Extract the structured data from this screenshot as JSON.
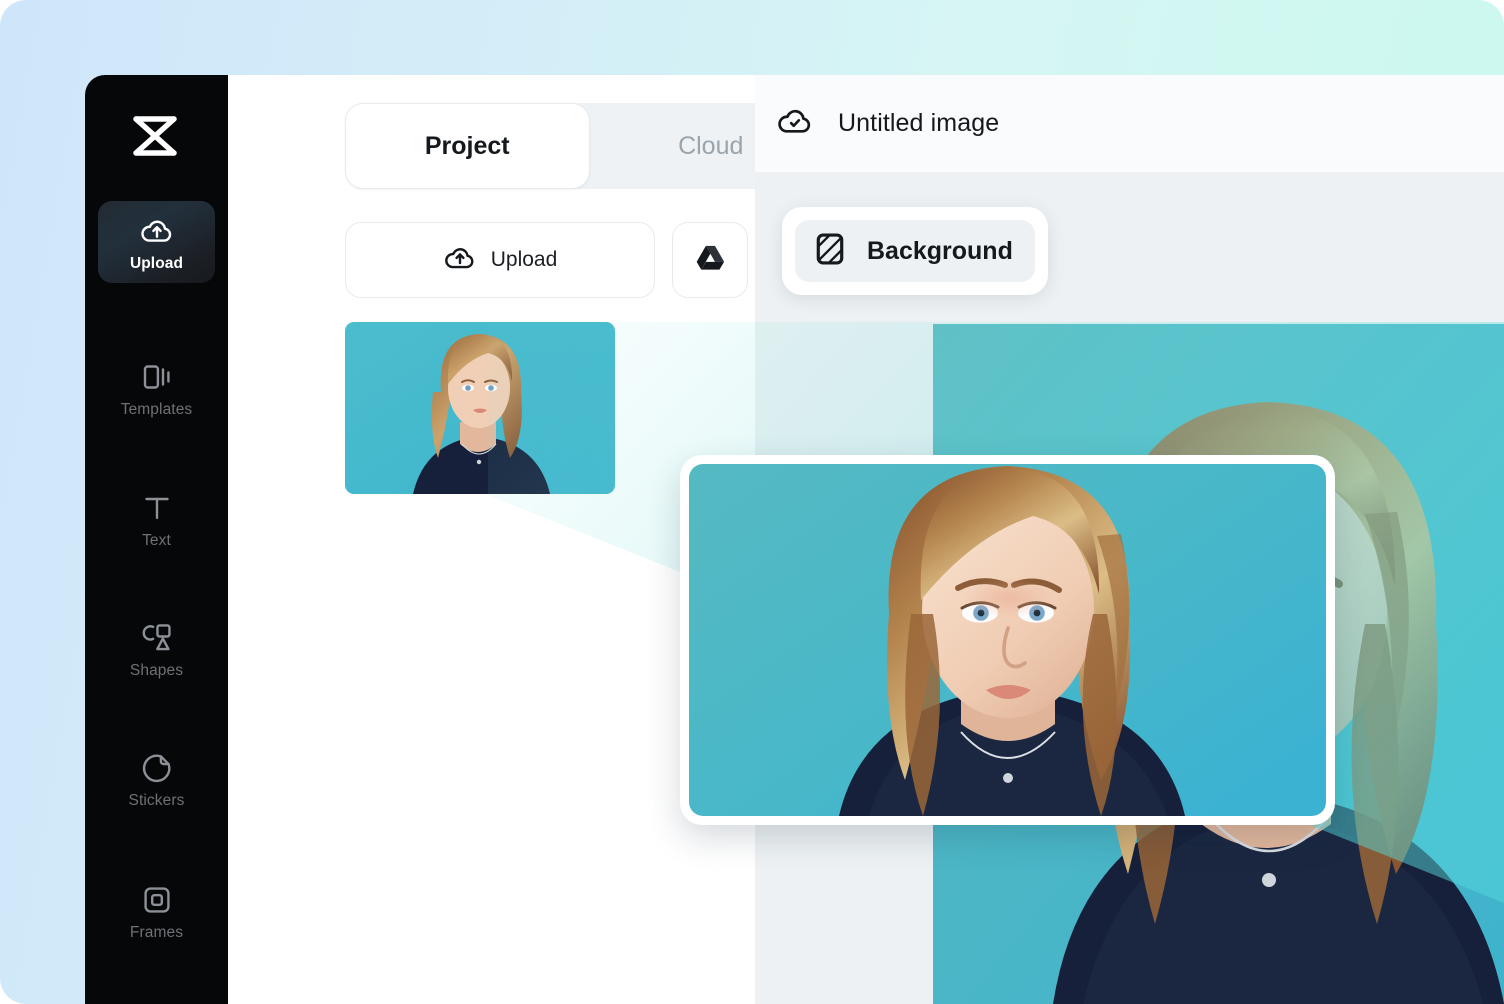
{
  "app": {
    "brand_icon": "capcut-logo-icon",
    "window_background_gradient": [
      "#cfe6fa",
      "#d6f6f4",
      "#c9f7ee"
    ]
  },
  "sidebar": {
    "items": [
      {
        "label": "Upload",
        "icon": "cloud-upload-icon",
        "active": true
      },
      {
        "label": "Templates",
        "icon": "templates-icon",
        "active": false
      },
      {
        "label": "Text",
        "icon": "text-t-icon",
        "active": false
      },
      {
        "label": "Shapes",
        "icon": "shapes-icon",
        "active": false
      },
      {
        "label": "Stickers",
        "icon": "sticker-icon",
        "active": false
      },
      {
        "label": "Frames",
        "icon": "frames-icon",
        "active": false
      }
    ],
    "active_background": "#232b33",
    "background": "#060708"
  },
  "left_panel": {
    "tabs": [
      {
        "label": "Project",
        "selected": true
      },
      {
        "label": "Cloud",
        "selected": false
      }
    ],
    "upload_button": {
      "label": "Upload",
      "icon": "cloud-upload-icon"
    },
    "cloud_sources": [
      {
        "name": "google-drive-icon"
      },
      {
        "name": "dropbox-icon"
      }
    ],
    "media_items": [
      {
        "name": "portrait-thumbnail",
        "alt": "Portrait of a woman on a teal background"
      }
    ]
  },
  "main": {
    "cloud_status_icon": "cloud-check-icon",
    "title": "Untitled image",
    "toolbar": {
      "background_button": {
        "label": "Background",
        "icon": "background-swatch-icon"
      }
    },
    "canvas": {
      "artwork_alt": "Portrait of a woman on a teal background",
      "background": "#edf1f3"
    },
    "preview_card": {
      "alt": "Zoomed preview of the portrait",
      "border_color": "#ffffff"
    }
  },
  "colors": {
    "canvas_bg": "#edf1f3",
    "panel_bg": "#ffffff",
    "topbar_bg": "#fafbfc",
    "segment_track": "#eef2f5",
    "text_primary": "#15181c",
    "text_muted": "#9aa4ad",
    "teal_photo_bg": "#4fb9c4",
    "beam_tint": "#7fe3e0"
  }
}
